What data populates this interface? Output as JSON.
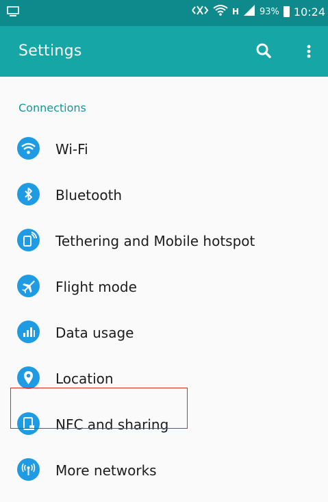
{
  "status_bar": {
    "battery_percent": "93%",
    "time": "10:24",
    "network_type": "H",
    "icons": [
      "screen-mirror-icon",
      "mute-icon",
      "wifi-icon",
      "signal-icon",
      "battery-icon"
    ]
  },
  "app_bar": {
    "title": "Settings",
    "actions": [
      "search-icon",
      "more-options-icon"
    ]
  },
  "section": {
    "title": "Connections"
  },
  "items": [
    {
      "label": "Wi-Fi",
      "icon": "wifi-icon"
    },
    {
      "label": "Bluetooth",
      "icon": "bluetooth-icon"
    },
    {
      "label": "Tethering and Mobile hotspot",
      "icon": "hotspot-icon"
    },
    {
      "label": "Flight mode",
      "icon": "airplane-icon"
    },
    {
      "label": "Data usage",
      "icon": "data-usage-icon"
    },
    {
      "label": "Location",
      "icon": "location-icon"
    },
    {
      "label": "NFC and sharing",
      "icon": "nfc-icon"
    },
    {
      "label": "More networks",
      "icon": "more-networks-icon"
    }
  ],
  "colors": {
    "status_bar": "#0e8a8c",
    "app_bar": "#16a6a6",
    "icon_bg": "#1e9be3",
    "section_text": "#16969a",
    "highlight_border": "#d32a2a"
  }
}
